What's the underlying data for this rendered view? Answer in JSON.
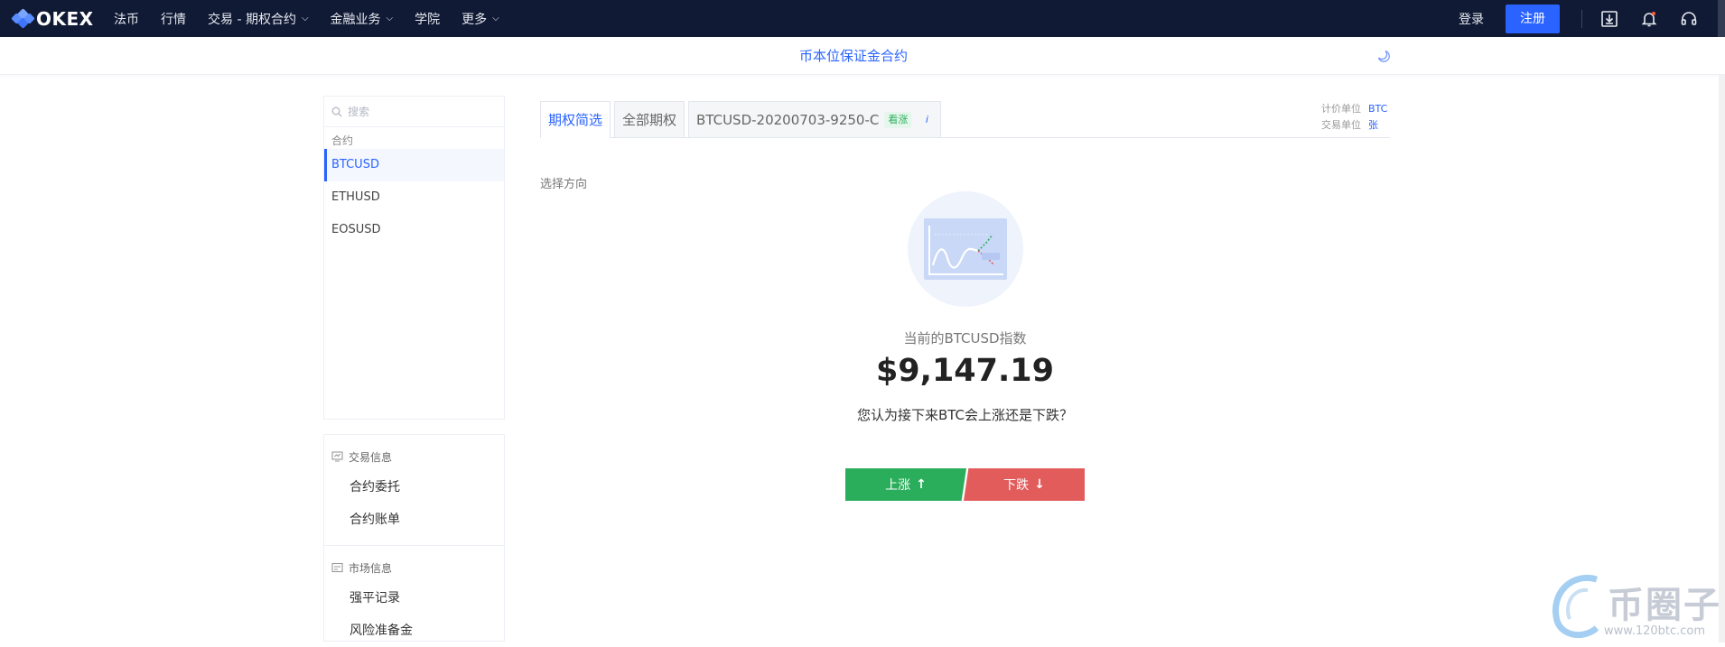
{
  "topbar": {
    "logo": "OKEX",
    "nav": [
      {
        "label": "法币",
        "dropdown": false
      },
      {
        "label": "行情",
        "dropdown": false
      },
      {
        "label": "交易 - 期权合约",
        "dropdown": true
      },
      {
        "label": "金融业务",
        "dropdown": true
      },
      {
        "label": "学院",
        "dropdown": false
      },
      {
        "label": "更多",
        "dropdown": true
      }
    ],
    "login": "登录",
    "register": "注册",
    "icons": [
      "download-icon",
      "bell-icon",
      "headset-icon"
    ]
  },
  "subbar": {
    "title": "币本位保证金合约"
  },
  "sidebar": {
    "search_placeholder": "搜索",
    "group_label": "合约",
    "contracts": [
      "BTCUSD",
      "ETHUSD",
      "EOSUSD"
    ],
    "active_contract": "BTCUSD",
    "sections": [
      {
        "title": "交易信息",
        "icon": "monitor-icon",
        "items": [
          "合约委托",
          "合约账单"
        ]
      },
      {
        "title": "市场信息",
        "icon": "card-icon",
        "items": [
          "强平记录",
          "风险准备金"
        ]
      }
    ]
  },
  "main": {
    "tabs": [
      {
        "label": "期权简选",
        "active": true
      },
      {
        "label": "全部期权",
        "active": false
      },
      {
        "label": "BTCUSD-20200703-9250-C",
        "active": false,
        "tag": "看涨",
        "info": "i"
      }
    ],
    "units": [
      {
        "key": "计价单位",
        "value": "BTC"
      },
      {
        "key": "交易单位",
        "value": "张"
      }
    ],
    "direction_label": "选择方向",
    "index_label": "当前的BTCUSD指数",
    "index_value": "$9,147.19",
    "question": "您认为接下来BTC会上涨还是下跌？",
    "up_button": "上涨",
    "down_button": "下跌",
    "up_arrow": "↑",
    "down_arrow": "↓"
  },
  "watermark": {
    "text": "币圈子",
    "url": "www.120btc.com"
  },
  "colors": {
    "nav_bg": "#101a34",
    "accent": "#2a63ff",
    "up": "#2bae5c",
    "down": "#e25c5c"
  }
}
